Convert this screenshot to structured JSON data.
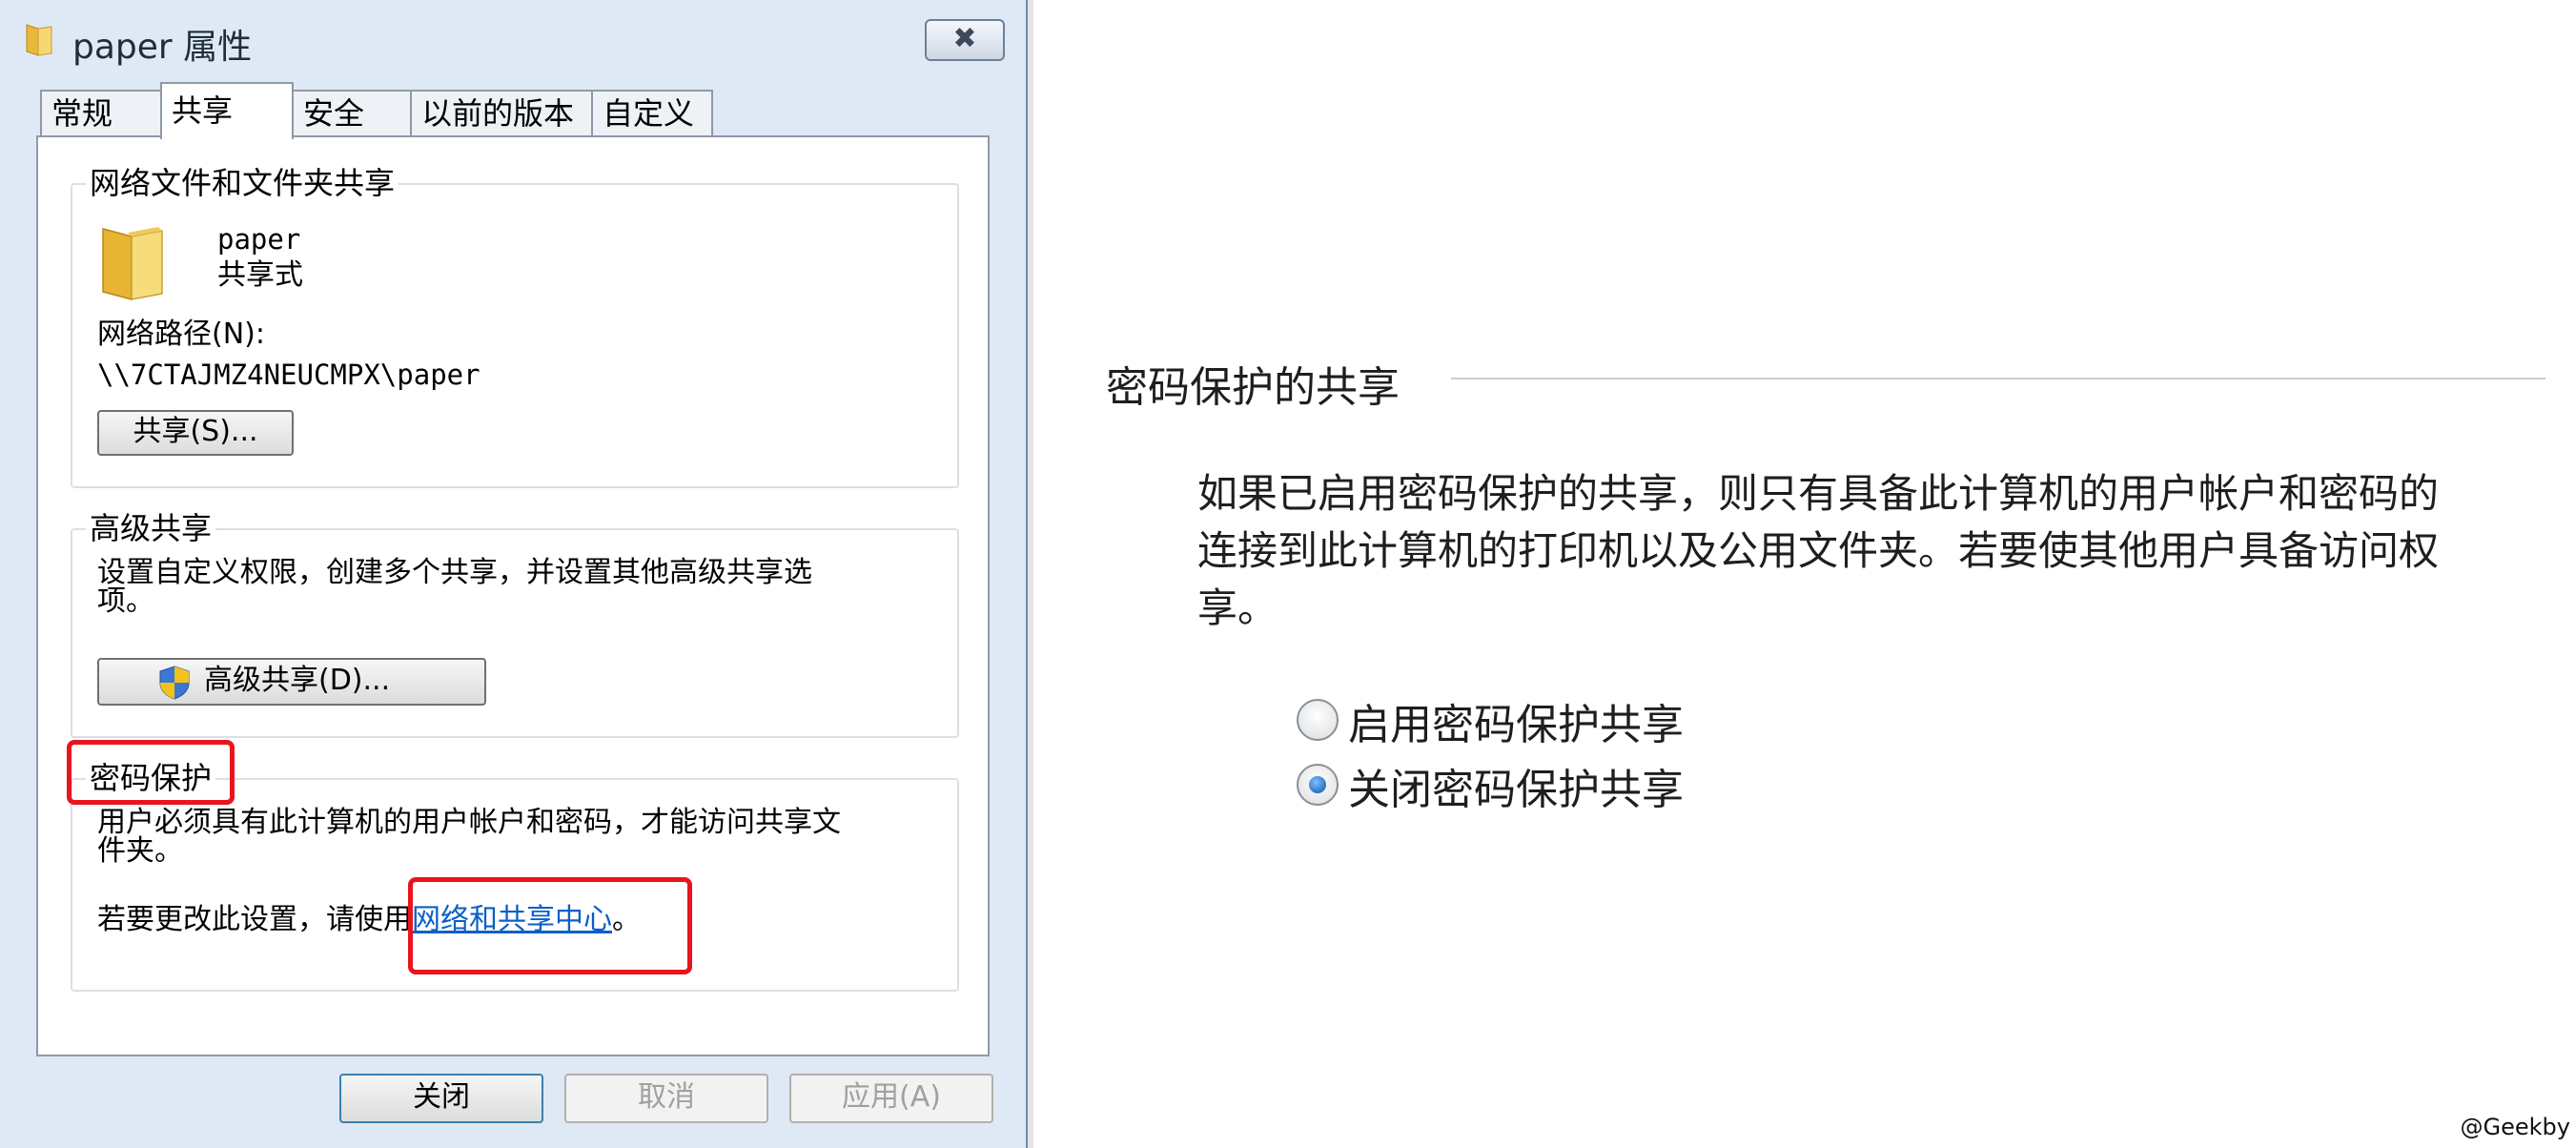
{
  "dialog": {
    "title": "paper 属性",
    "close_symbol": "✖",
    "tabs": [
      {
        "label": "常规"
      },
      {
        "label": "共享"
      },
      {
        "label": "安全"
      },
      {
        "label": "以前的版本"
      },
      {
        "label": "自定义"
      }
    ],
    "active_tab": "共享",
    "network_sharing": {
      "legend": "网络文件和文件夹共享",
      "folder_name": "paper",
      "share_status": "共享式",
      "path_label": "网络路径(N):",
      "path_value": "\\\\7CTAJMZ4NEUCMPX\\paper",
      "share_button": "共享(S)..."
    },
    "advanced_sharing": {
      "legend": "高级共享",
      "description_line1": "设置自定义权限，创建多个共享，并设置其他高级共享选",
      "description_line2": "项。",
      "button": "高级共享(D)..."
    },
    "password_protection": {
      "legend": "密码保护",
      "description_line1": "用户必须具有此计算机的用户帐户和密码，才能访问共享文",
      "description_line2": "件夹。",
      "change_prefix": "若要更改此设置，请使用",
      "link_text": "网络和共享中心",
      "change_suffix": "。"
    },
    "buttons": {
      "close": "关闭",
      "cancel": "取消",
      "apply": "应用(A)"
    }
  },
  "right_panel": {
    "heading": "密码保护的共享",
    "paragraph_lines": [
      "如果已启用密码保护的共享，则只有具备此计算机的用户帐户和密码的",
      "连接到此计算机的打印机以及公用文件夹。若要使其他用户具备访问权",
      "享。"
    ],
    "options": [
      {
        "label": "启用密码保护共享",
        "selected": false
      },
      {
        "label": "关闭密码保护共享",
        "selected": true
      }
    ]
  },
  "credit": "@Geekby",
  "colors": {
    "highlight_box": "#e8141e",
    "link": "#0b5fc9",
    "dialog_frame": "#dfe9f5"
  }
}
